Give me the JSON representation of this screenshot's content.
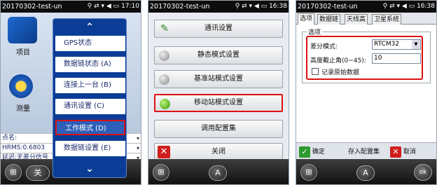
{
  "s1": {
    "title": "20170302-test-un",
    "time": "17:10",
    "status_icons": "⚲ ⇄ ▾ ◀ ▭",
    "desktop": {
      "item1": "项目",
      "item2": "测量"
    },
    "info": [
      "点名:",
      "HRMS:0.6803",
      "延迟:无差分信号"
    ],
    "menu": [
      "GPS状态",
      "数据链状态 (A)",
      "连接上一台 (B)",
      "通讯设置 (C)",
      "工作模式 (D)",
      "数据链设置 (E)"
    ],
    "soft_left": "关"
  },
  "s2": {
    "title": "20170302-test-un",
    "time": "16:38",
    "status_icons": "⚲ ⇄ ▾ ◀ ▭",
    "buttons": [
      "通讯设置",
      "静态模式设置",
      "基准站模式设置",
      "移动站模式设置",
      "调用配置集",
      "关闭"
    ],
    "soft_a": "A"
  },
  "s3": {
    "title": "20170302-test-un",
    "time": "16:38",
    "status_icons": "⚲ ⇄ ▾ ◀ ▭",
    "tabs": [
      "选项",
      "数据链",
      "天线高",
      "卫星系统"
    ],
    "group_label": "选项",
    "diff_label": "差分模式:",
    "diff_value": "RTCM32",
    "elev_label": "高度截止角(0~45):",
    "elev_value": "10",
    "record_label": "记录原始数据",
    "btn_ok": "确定",
    "btn_save": "存入配置集",
    "btn_cancel": "取消",
    "soft_a": "A",
    "soft_ok": "ok"
  }
}
